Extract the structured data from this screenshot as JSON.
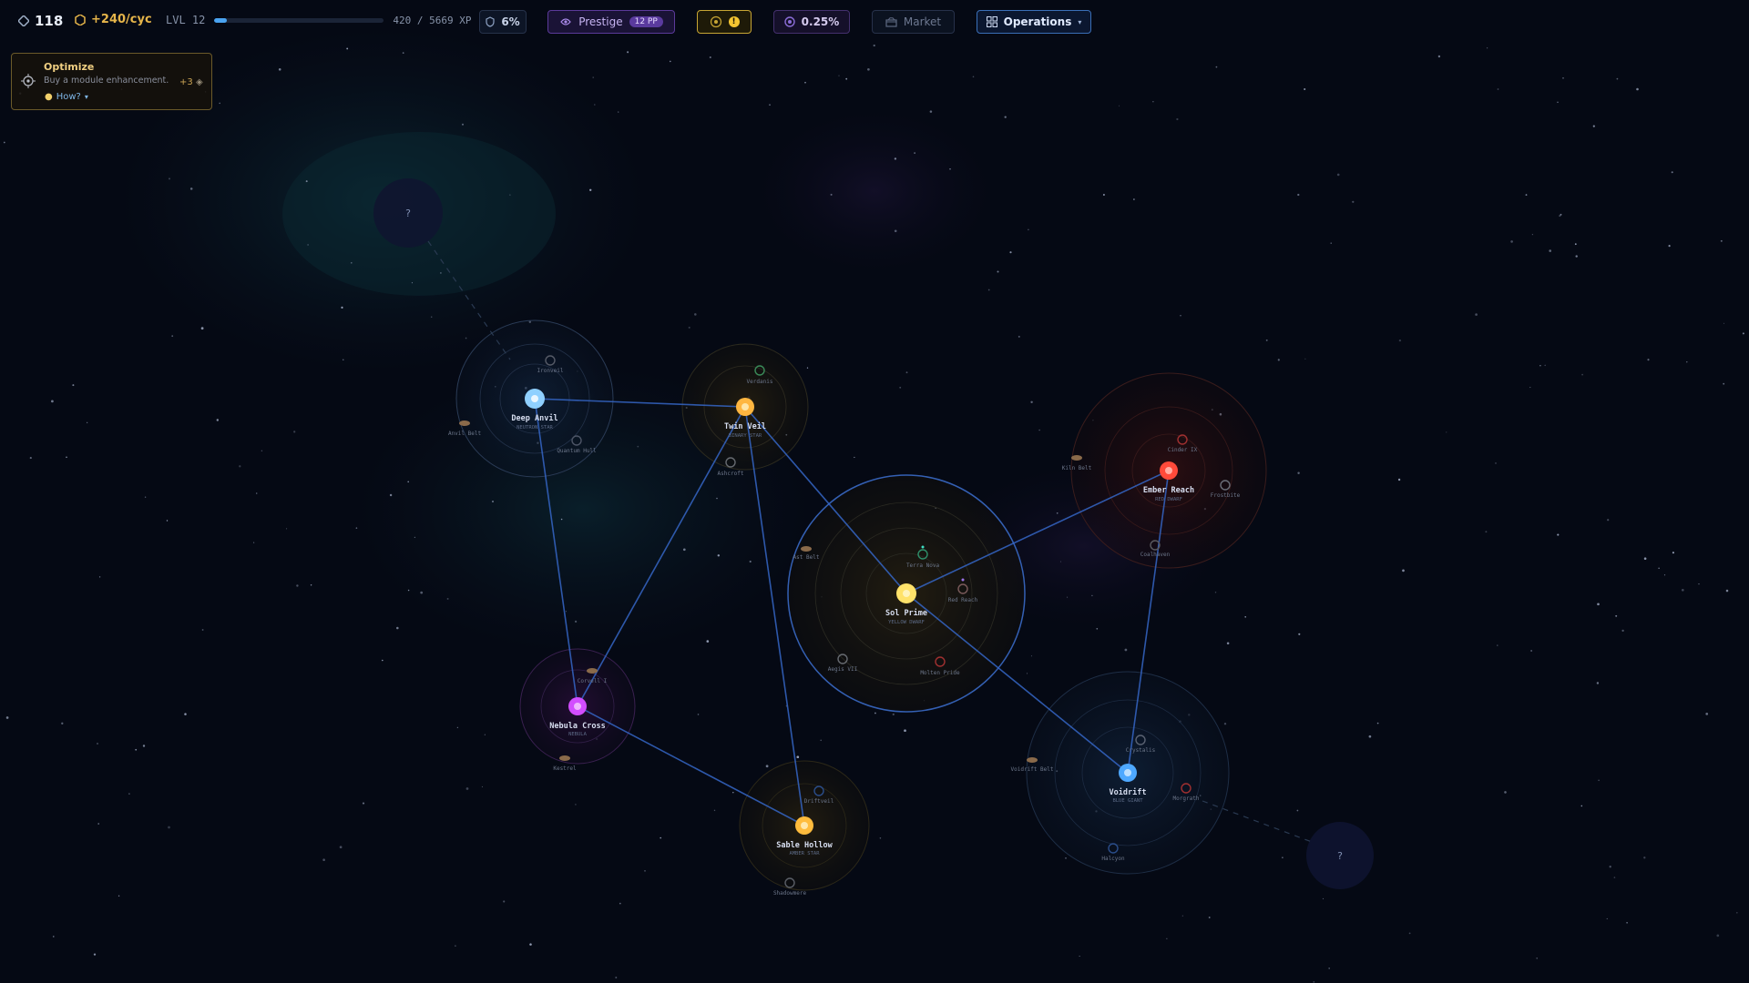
{
  "hud": {
    "crystals": "118",
    "income": "+240/cyc",
    "level_label": "LVL 12",
    "xp_text": "420 / 5669 XP",
    "xp_fraction": 0.074,
    "shield_pct": "6%",
    "prestige_label": "Prestige",
    "prestige_points": "12 PP",
    "rate_label": "0.25%",
    "market_label": "Market",
    "operations_label": "Operations",
    "colors": {
      "accent": "#4aa3f0",
      "gold": "#e6b54a",
      "purple": "#9b72e6"
    }
  },
  "objective": {
    "title": "Optimize",
    "description": "Buy a module enhancement.",
    "reward": "+3",
    "how_label": "How?"
  },
  "systems": [
    {
      "id": "deep_anvil",
      "name": "Deep Anvil",
      "type": "NEUTRON STAR",
      "star_color": "#8fd0ff",
      "bodies": [
        "Ironveil",
        "Quantum Hull",
        "Anvil Belt"
      ]
    },
    {
      "id": "twin_veil",
      "name": "Twin Veil",
      "type": "BINARY STAR",
      "star_color": "#ffb640",
      "bodies": [
        "Verdanis",
        "Ashcroft"
      ]
    },
    {
      "id": "sol_prime",
      "name": "Sol Prime",
      "type": "YELLOW DWARF",
      "star_color": "#ffe26a",
      "bodies": [
        "Terra Nova",
        "Red Reach",
        "Aegis VII",
        "Molten Pride",
        "Ast Belt"
      ]
    },
    {
      "id": "ember_reach",
      "name": "Ember Reach",
      "type": "RED DWARF",
      "star_color": "#ff4a3a",
      "bodies": [
        "Cinder IX",
        "Kiln Belt",
        "Frostbite",
        "Coalhaven"
      ]
    },
    {
      "id": "nebula_cross",
      "name": "Nebula Cross",
      "type": "NEBULA",
      "star_color": "#d24dff",
      "bodies": [
        "Corvell I",
        "Kestrel"
      ]
    },
    {
      "id": "sable_hollow",
      "name": "Sable Hollow",
      "type": "AMBER STAR",
      "star_color": "#ffbc3d",
      "bodies": [
        "Driftveil",
        "Shadowmere"
      ]
    },
    {
      "id": "voidrift",
      "name": "Voidrift",
      "type": "BLUE GIANT",
      "star_color": "#4ea8ff",
      "bodies": [
        "Crystalis",
        "Voidrift Belt",
        "Morgrath",
        "Halcyon"
      ]
    }
  ],
  "unknown_marker": "?"
}
